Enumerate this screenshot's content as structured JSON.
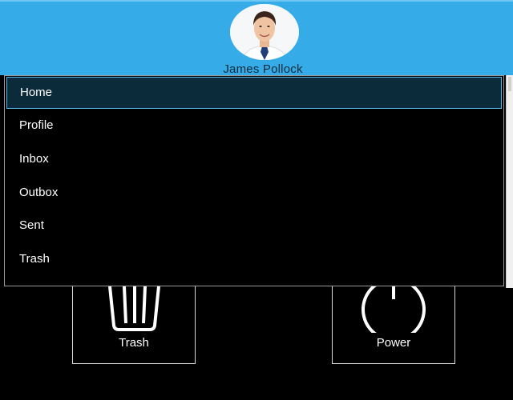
{
  "header": {
    "user_name": "James Pollock",
    "bg_color": "#35ace8"
  },
  "menu": {
    "items": [
      {
        "label": "Home",
        "selected": true
      },
      {
        "label": "Profile",
        "selected": false
      },
      {
        "label": "Inbox",
        "selected": false
      },
      {
        "label": "Outbox",
        "selected": false
      },
      {
        "label": "Sent",
        "selected": false
      },
      {
        "label": "Trash",
        "selected": false
      }
    ]
  },
  "tiles": [
    {
      "label": "Trash",
      "icon": "trash-icon"
    },
    {
      "label": "Power",
      "icon": "power-icon"
    }
  ]
}
